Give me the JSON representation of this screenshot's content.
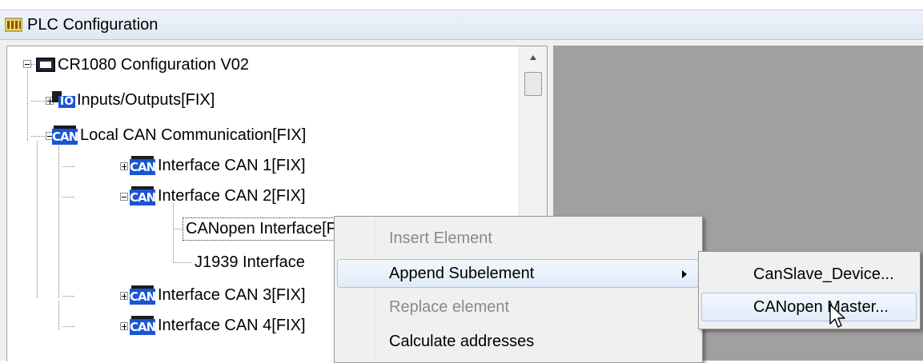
{
  "window": {
    "title": "PLC Configuration",
    "title_icon": "plc-config-icon"
  },
  "tree": {
    "nodes": [
      {
        "label": "CR1080 Configuration V02",
        "icon": "monitor-icon",
        "expander": "-"
      },
      {
        "label": "Inputs/Outputs[FIX]",
        "icon": "io-icon",
        "expander": "+"
      },
      {
        "label": "Local CAN Communication[FIX]",
        "icon": "can-icon",
        "icon_text": "CAN",
        "expander": "-"
      },
      {
        "label": "Interface CAN 1[FIX]",
        "icon": "can-icon",
        "icon_text": "CAN",
        "expander": "+"
      },
      {
        "label": "Interface CAN 2[FIX]",
        "icon": "can-icon",
        "icon_text": "CAN",
        "expander": "-"
      },
      {
        "label": "CANopen Interface[FIX]",
        "selected": true
      },
      {
        "label": "J1939 Interface"
      },
      {
        "label": "Interface CAN 3[FIX]",
        "icon": "can-icon",
        "icon_text": "CAN",
        "expander": "+"
      },
      {
        "label": "Interface CAN 4[FIX]",
        "icon": "can-icon",
        "icon_text": "CAN",
        "expander": "+"
      }
    ],
    "io_icon_text": "IO"
  },
  "context_menu": {
    "items": [
      {
        "label": "Insert Element",
        "enabled": false
      },
      {
        "label": "Append Subelement",
        "enabled": true,
        "has_submenu": true,
        "highlighted": true
      },
      {
        "label": "Replace element",
        "enabled": false
      },
      {
        "label": "Calculate addresses",
        "enabled": true
      }
    ]
  },
  "submenu": {
    "items": [
      {
        "label": "CanSlave_Device...",
        "enabled": true
      },
      {
        "label": "CANopen Master...",
        "enabled": true,
        "highlighted": true
      }
    ]
  },
  "colors": {
    "can_icon_blue": "#1a55d6",
    "menu_highlight_border": "#a7c4e8",
    "right_pane_gray": "#a0a0a0"
  }
}
